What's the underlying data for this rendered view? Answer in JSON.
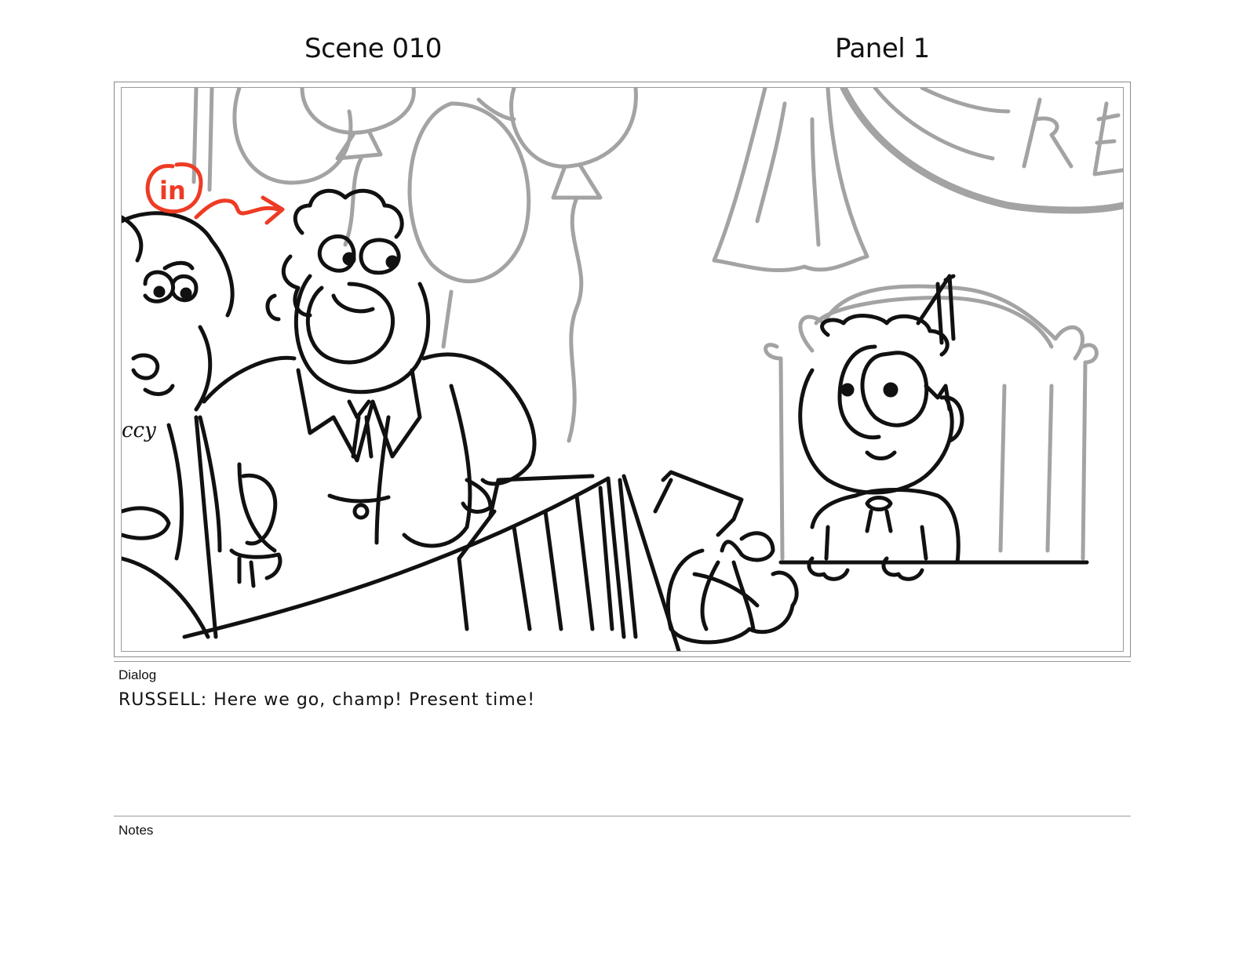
{
  "header": {
    "scene": "Scene 010",
    "panel": "Panel 1"
  },
  "drawing": {
    "annotation_text": "in",
    "sign_text": "RE",
    "necklace_text": "ccy",
    "ink_color": "#111111",
    "background_ink_color": "#a3a3a3",
    "annotation_color": "#ee3b24"
  },
  "dialog": {
    "label": "Dialog",
    "text": "RUSSELL:  Here we go, champ! Present time!"
  },
  "notes": {
    "label": "Notes"
  }
}
